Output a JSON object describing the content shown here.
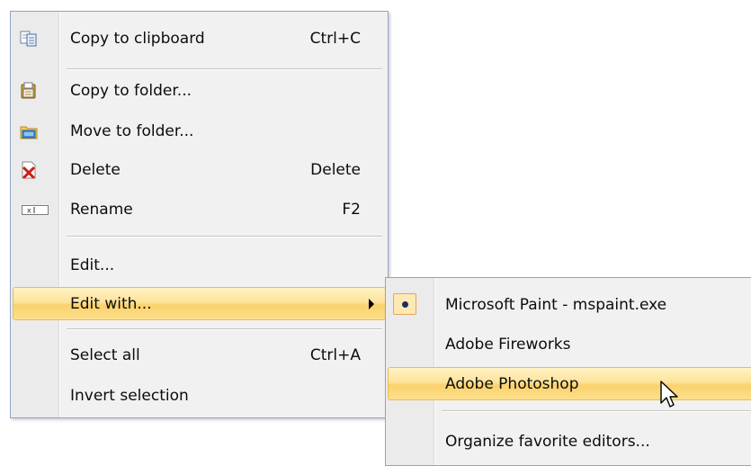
{
  "main_menu": {
    "items": [
      {
        "label": "Copy to clipboard",
        "shortcut": "Ctrl+C",
        "icon": "copy-icon"
      },
      {
        "label": "Copy to folder...",
        "shortcut": "",
        "icon": "copy-to-folder-icon"
      },
      {
        "label": "Move to folder...",
        "shortcut": "",
        "icon": "move-to-folder-icon"
      },
      {
        "label": "Delete",
        "shortcut": "Delete",
        "icon": "delete-icon"
      },
      {
        "label": "Rename",
        "shortcut": "F2",
        "icon": "rename-icon"
      },
      {
        "label": "Edit...",
        "shortcut": ""
      },
      {
        "label": "Edit with...",
        "shortcut": "",
        "has_submenu": true
      },
      {
        "label": "Select all",
        "shortcut": "Ctrl+A"
      },
      {
        "label": "Invert selection",
        "shortcut": ""
      }
    ]
  },
  "sub_menu": {
    "items": [
      {
        "label": "Microsoft Paint - mspaint.exe",
        "checked": true
      },
      {
        "label": "Adobe Fireworks"
      },
      {
        "label": "Adobe Photoshop",
        "hovered": true
      },
      {
        "label": "Organize favorite editors..."
      }
    ]
  },
  "colors": {
    "highlight": "#fbd26b",
    "border": "#8fa4c9",
    "menu_bg": "#f1f1f1"
  }
}
